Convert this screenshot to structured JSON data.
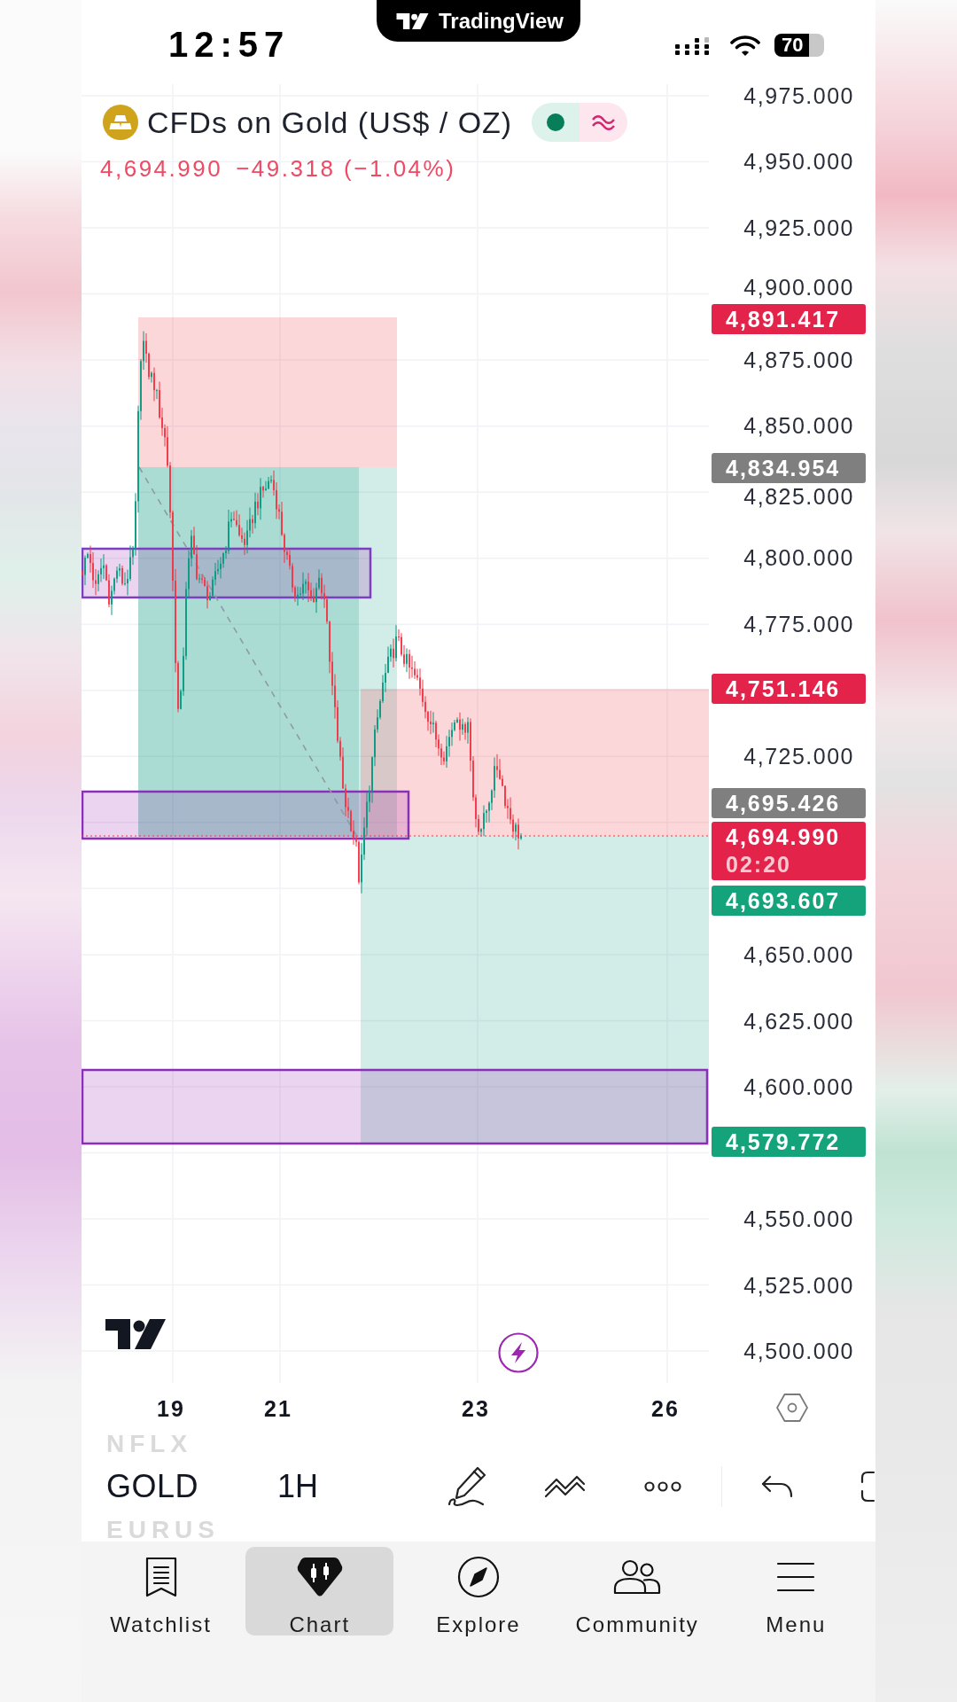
{
  "status_bar": {
    "time": "12:57",
    "app_name": "TradingView",
    "battery": "70"
  },
  "legend": {
    "title": "CFDs on Gold (US$ / OZ)",
    "last_price": "4,694.990",
    "change": "−49.318 (−1.04%)"
  },
  "price_axis": {
    "labels": [
      "4,975.000",
      "4,950.000",
      "4,925.000",
      "4,900.000",
      "4,875.000",
      "4,850.000",
      "4,825.000",
      "4,800.000",
      "4,775.000",
      "4,725.000",
      "4,650.000",
      "4,625.000",
      "4,600.000",
      "4,550.000",
      "4,525.000",
      "4,500.000"
    ],
    "tags": [
      {
        "value": "4,891.417",
        "color": "#e3234a"
      },
      {
        "value": "4,834.954",
        "color": "#7f7f7f"
      },
      {
        "value": "4,751.146",
        "color": "#e3234a"
      },
      {
        "value": "4,695.426",
        "color": "#7f7f7f"
      },
      {
        "value": "4,694.990",
        "countdown": "02:20",
        "color": "#e3234a"
      },
      {
        "value": "4,693.607",
        "color": "#15a37b"
      },
      {
        "value": "4,579.772",
        "color": "#15a37b"
      }
    ]
  },
  "time_axis": {
    "labels": [
      "19",
      "21",
      "23",
      "26"
    ]
  },
  "toolbar": {
    "symbols": [
      {
        "label": "NFLX",
        "selected": false
      },
      {
        "label": "GOLD",
        "selected": true
      },
      {
        "label": "EURUS",
        "selected": false
      }
    ],
    "interval": "1H"
  },
  "tab_bar": {
    "tabs": [
      {
        "label": "Watchlist",
        "selected": false
      },
      {
        "label": "Chart",
        "selected": true
      },
      {
        "label": "Explore",
        "selected": false
      },
      {
        "label": "Community",
        "selected": false
      },
      {
        "label": "Menu",
        "selected": false
      }
    ]
  }
}
